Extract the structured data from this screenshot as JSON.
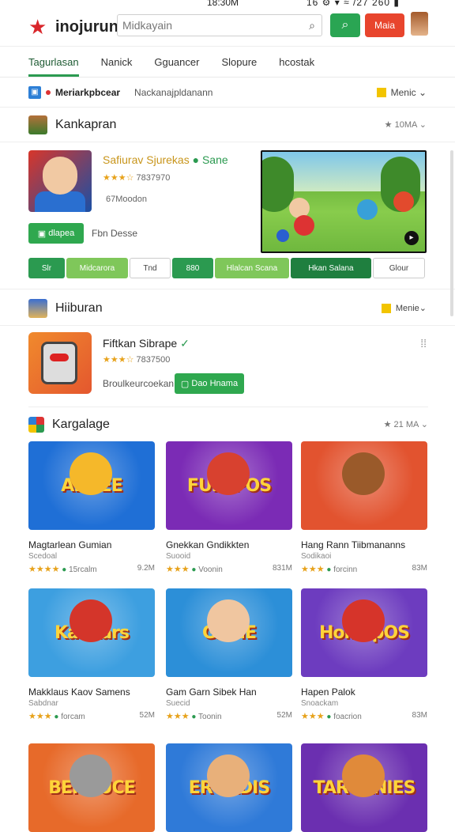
{
  "status": {
    "time": "18:30M",
    "right": "16 ⚙ ▾ ≈ /27 260 ▮"
  },
  "header": {
    "brand": "inojurun",
    "search_placeholder": "Midkayain",
    "red_button": "Maia"
  },
  "tabs": [
    "Tagurlasan",
    "Nanick",
    "Gguancer",
    "Slopure",
    "hcostak"
  ],
  "subbar": {
    "left": "Meriarkpbcear",
    "right": "Nackanajpldanann",
    "menu": "Menic"
  },
  "section1": {
    "title": "Kankapran",
    "meta": "★ 10MA"
  },
  "featured": {
    "name": "Safiurav Sjurekas",
    "badge_text": "Sane",
    "stars": "★★★☆",
    "rating": "7837970",
    "downloads": "67Moodon",
    "install_label": "dlapea",
    "desc": "Fbn Desse",
    "actions": [
      "Slr",
      "Midcarora",
      "Tnd",
      "880",
      "Hlalcan Scana",
      "Hkan Salana",
      "Glour"
    ]
  },
  "section2": {
    "title": "Hiiburan",
    "menu": "Menie"
  },
  "hiburan_app": {
    "name": "Fiftkan Sibrape",
    "stars": "★★★☆",
    "rating": "7837500",
    "dev": "Broulkeurcoekan",
    "btn": "Dao Hnama"
  },
  "section3": {
    "title": "Kargalage",
    "meta": "★ 21 MA"
  },
  "games": [
    {
      "art": "ARHEE",
      "title": "Magtarlean Gumian",
      "sub": "Scedoal",
      "stars": "★★★★",
      "downloads": "15rcalm",
      "size": "9.2M",
      "bg": "#1f6fd6",
      "mascot": "#f5b82a"
    },
    {
      "art": "FUlIaPOS",
      "title": "Gnekkan Gndikkten",
      "sub": "Suooid",
      "stars": "★★★",
      "downloads": "Voonin",
      "size": "831M",
      "bg": "#7b2bb5",
      "mascot": "#d8412f"
    },
    {
      "art": "",
      "title": "Hang Rann Tiibmananns",
      "sub": "Sodikaoi",
      "stars": "★★★",
      "downloads": "forcinn",
      "size": "83M",
      "bg": "#e2532f",
      "mascot": "#9a5a2a"
    },
    {
      "art": "Kankars",
      "title": "Makklaus Kaov Samens",
      "sub": "Sabdnar",
      "stars": "★★★",
      "downloads": "forcam",
      "size": "52M",
      "bg": "#3d9fe0",
      "mascot": "#d4352a"
    },
    {
      "art": "GAME",
      "title": "Gam Garn Sibek Han",
      "sub": "Suecid",
      "stars": "★★★",
      "downloads": "Toonin",
      "size": "52M",
      "bg": "#2c8fd8",
      "mascot": "#f0c6a0"
    },
    {
      "art": "HolnepOS",
      "title": "Hapen Palok",
      "sub": "Snoackam",
      "stars": "★★★",
      "downloads": "foacrion",
      "size": "83M",
      "bg": "#6d3cbf",
      "mascot": "#d6342a"
    },
    {
      "art": "BEROUCE",
      "title": "",
      "sub": "",
      "stars": "",
      "downloads": "",
      "size": "",
      "bg": "#e76a2a",
      "mascot": "#9a9a9a"
    },
    {
      "art": "EROADIS",
      "title": "",
      "sub": "",
      "stars": "",
      "downloads": "",
      "size": "",
      "bg": "#2f7ad8",
      "mascot": "#e8b07a"
    },
    {
      "art": "TARCANIES",
      "title": "",
      "sub": "",
      "stars": "",
      "downloads": "",
      "size": "",
      "bg": "#6b2fb0",
      "mascot": "#e08a3a"
    }
  ]
}
